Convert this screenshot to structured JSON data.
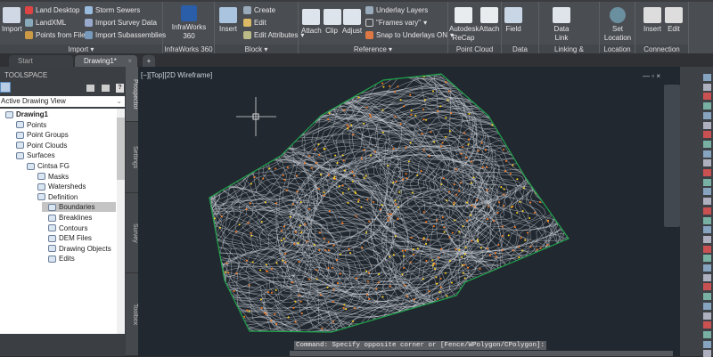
{
  "ribbon": {
    "import": {
      "label": "Import",
      "big": "Import",
      "items": [
        "Land Desktop",
        "LandXML",
        "Points from File",
        "Storm Sewers",
        "Import Survey Data",
        "Import Subassemblies"
      ]
    },
    "infraworks": {
      "label": "InfraWorks 360",
      "big": "InfraWorks 360"
    },
    "block": {
      "label": "Block",
      "big": "Insert",
      "items": [
        "Create",
        "Edit",
        "Edit Attributes"
      ]
    },
    "reference": {
      "label": "Reference",
      "big": [
        "Attach",
        "Clip",
        "Adjust"
      ],
      "items": [
        "Underlay Layers",
        "\"Frames vary\"",
        "Snap to Underlays ON"
      ]
    },
    "pointcloud": {
      "label": "Point Cloud",
      "big": [
        "Autodesk ReCap",
        "Attach"
      ]
    },
    "data": {
      "label": "Data",
      "big": "Field"
    },
    "linking": {
      "label": "Linking & Extraction",
      "big": "Data Link"
    },
    "location": {
      "label": "Location",
      "big": "Set Location"
    },
    "connection": {
      "label": "Connection Point",
      "big": [
        "Insert",
        "Edit"
      ]
    }
  },
  "tabs": [
    "Start",
    "Drawing1*"
  ],
  "toolspace": {
    "title": "TOOLSPACE",
    "view": "Active Drawing View",
    "side_tabs": [
      "Prospector",
      "Settings",
      "Survey",
      "Toolbox"
    ],
    "tree": [
      "Drawing1",
      "Points",
      "Point Groups",
      "Point Clouds",
      "Surfaces",
      "Cintsa FG",
      "Masks",
      "Watersheds",
      "Definition",
      "Boundaries",
      "Breaklines",
      "Contours",
      "DEM Files",
      "Drawing Objects",
      "Edits"
    ]
  },
  "viewport": {
    "label": "[−][Top][2D Wireframe]",
    "command": "Command: Specify opposite corner or [Fence/WPolygon/CPolygon]:"
  },
  "colors": {
    "boundary": "#1fa34a",
    "contour": "#d8dde3",
    "points": "#ff7a1a",
    "background": "#212830"
  }
}
